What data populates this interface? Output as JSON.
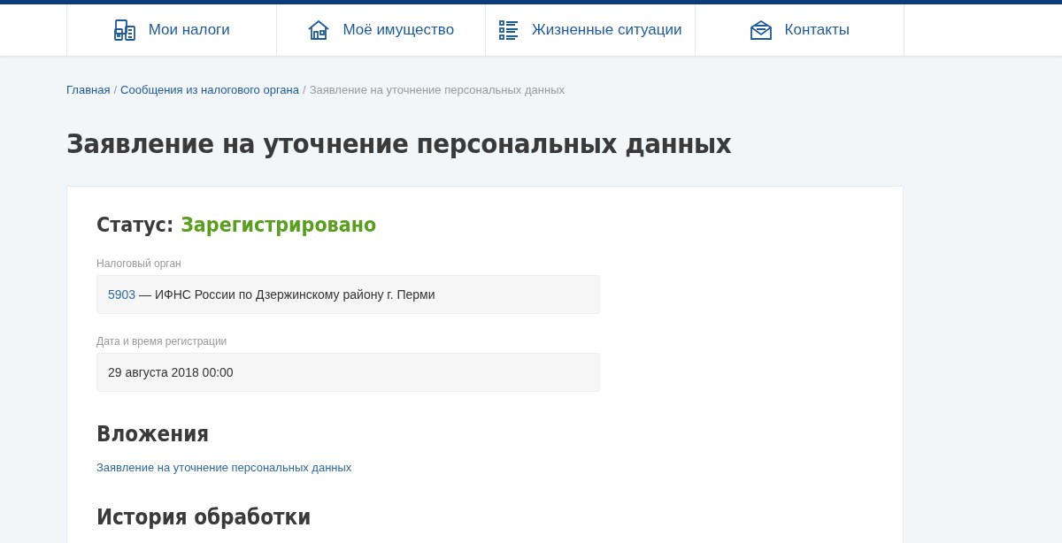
{
  "nav": [
    {
      "label": "Мои налоги"
    },
    {
      "label": "Моё имущество"
    },
    {
      "label": "Жизненные ситуации"
    },
    {
      "label": "Контакты"
    }
  ],
  "breadcrumb": {
    "separator": "/",
    "links": [
      "Главная",
      "Сообщения из налогового органа"
    ],
    "current": "Заявление на уточнение персональных данных"
  },
  "title": "Заявление на уточнение персональных данных",
  "status": {
    "label": "Статус:",
    "value": "Зарегистрировано"
  },
  "fields": [
    {
      "label": "Налоговый орган",
      "code": "5903",
      "value": " — ИФНС России по Дзержинскому району г. Перми"
    },
    {
      "label": "Дата и время регистрации",
      "value": "29 августа 2018 00:00"
    }
  ],
  "attachments": {
    "heading": "Вложения",
    "links": [
      "Заявление на уточнение персональных данных"
    ]
  },
  "history": {
    "heading": "История обработки"
  }
}
